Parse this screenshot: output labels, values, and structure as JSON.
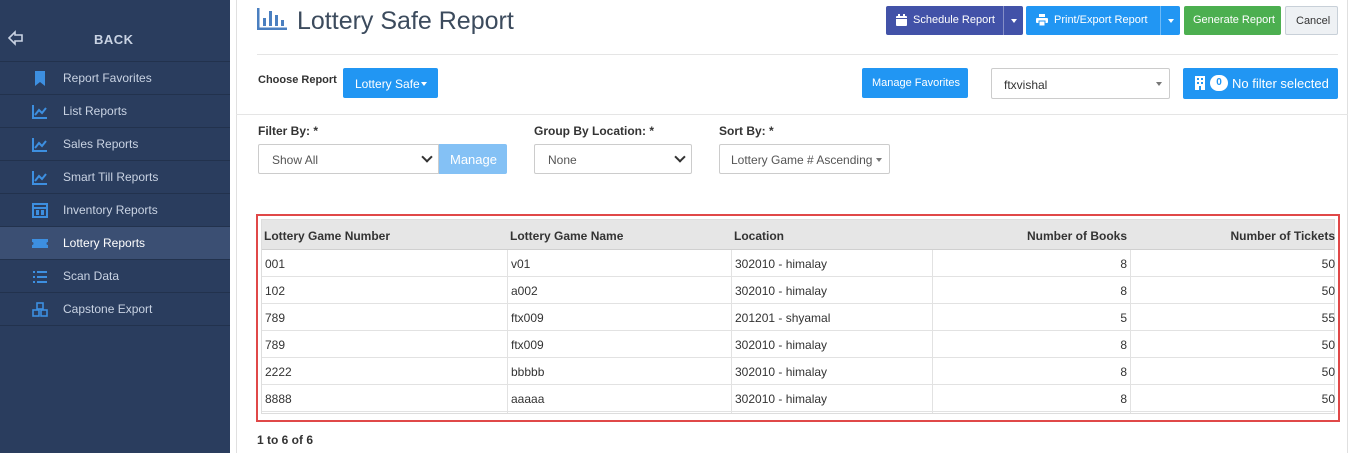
{
  "sidebar": {
    "back_label": "BACK",
    "items": [
      {
        "label": "Report Favorites",
        "icon": "bookmark-icon"
      },
      {
        "label": "List Reports",
        "icon": "line-chart-icon"
      },
      {
        "label": "Sales Reports",
        "icon": "line-chart-icon"
      },
      {
        "label": "Smart Till Reports",
        "icon": "line-chart-icon"
      },
      {
        "label": "Inventory Reports",
        "icon": "inventory-icon"
      },
      {
        "label": "Lottery Reports",
        "icon": "ticket-icon",
        "active": true
      },
      {
        "label": "Scan Data",
        "icon": "list-icon"
      },
      {
        "label": "Capstone Export",
        "icon": "cubes-icon"
      }
    ]
  },
  "header": {
    "title": "Lottery Safe Report",
    "schedule_label": "Schedule Report",
    "print_label": "Print/Export Report",
    "generate_label": "Generate Report",
    "cancel_label": "Cancel"
  },
  "toolbar": {
    "choose_label": "Choose Report",
    "report_select": "Lottery Safe",
    "manage_favorites_label": "Manage Favorites",
    "user_select": "ftxvishal",
    "filter_count": "0",
    "filter_label": "No filter selected"
  },
  "filters": {
    "filter_by_label": "Filter By: *",
    "filter_by_value": "Show All",
    "manage_label": "Manage",
    "group_by_label": "Group By Location: *",
    "group_by_value": "None",
    "sort_by_label": "Sort By: *",
    "sort_by_value": "Lottery Game # Ascending"
  },
  "table": {
    "columns": [
      "Lottery Game Number",
      "Lottery Game Name",
      "Location",
      "Number of Books",
      "Number of Tickets"
    ],
    "rows": [
      [
        "001",
        "v01",
        "302010 - himalay",
        "8",
        "50"
      ],
      [
        "102",
        "a002",
        "302010 - himalay",
        "8",
        "50"
      ],
      [
        "789",
        "ftx009",
        "201201 - shyamal",
        "5",
        "55"
      ],
      [
        "789",
        "ftx009",
        "302010 - himalay",
        "8",
        "50"
      ],
      [
        "2222",
        "bbbbb",
        "302010 - himalay",
        "8",
        "50"
      ],
      [
        "8888",
        "aaaaa",
        "302010 - himalay",
        "8",
        "50"
      ]
    ]
  },
  "pager": "1 to 6 of 6",
  "colors": {
    "sidebar_bg": "#2a3d5e",
    "primary": "#2196f3",
    "schedule": "#4252a8",
    "generate": "#4caf50",
    "highlight_border": "#e04848"
  }
}
